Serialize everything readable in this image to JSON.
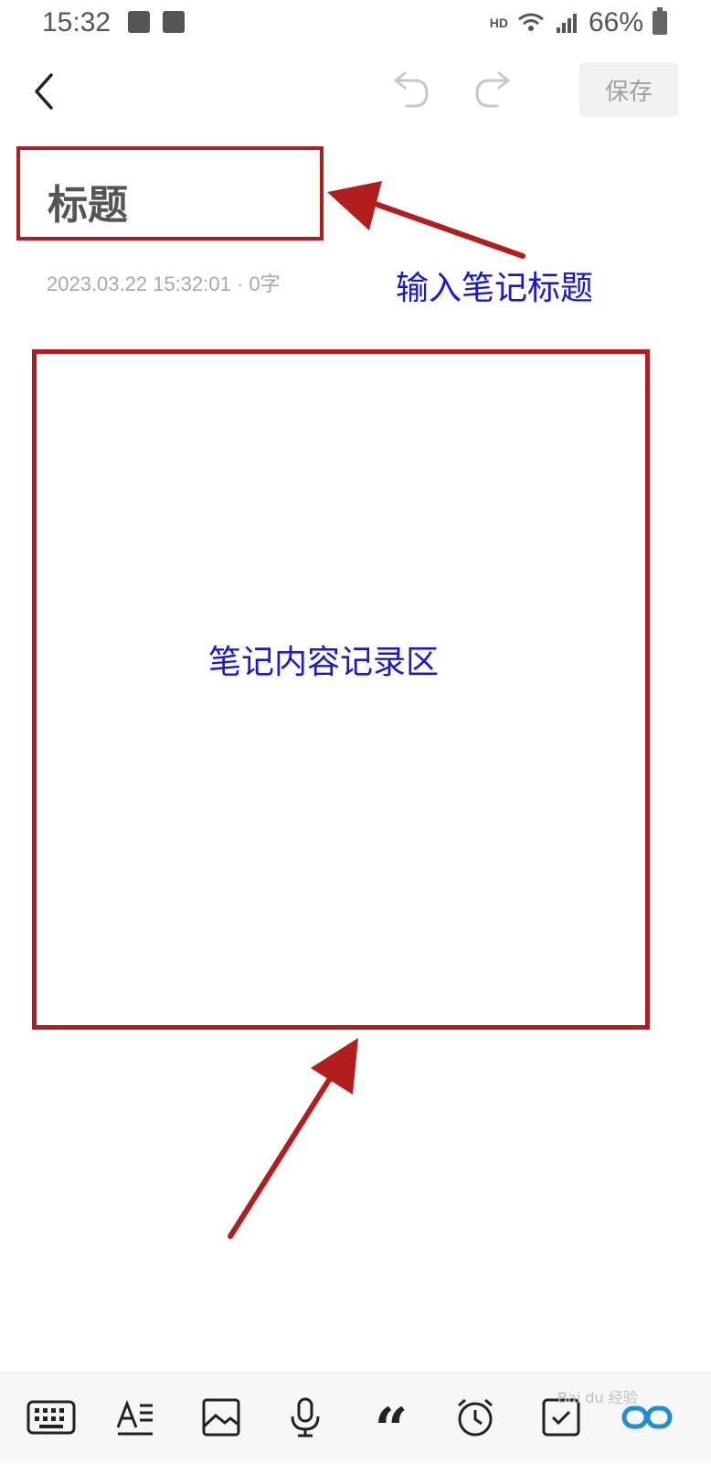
{
  "status_bar": {
    "time": "15:32",
    "network_label": "HD",
    "battery_percent": "66%",
    "icons": [
      "image-icon",
      "check-icon",
      "wifi-icon",
      "signal-4g-icon",
      "battery-icon"
    ]
  },
  "header": {
    "save_label": "保存",
    "icons": [
      "back-icon",
      "undo-icon",
      "redo-icon"
    ]
  },
  "note": {
    "title_placeholder": "标题",
    "meta": "2023.03.22 15:32:01 · 0字",
    "content_value": ""
  },
  "annotations": {
    "title_hint": "输入笔记标题",
    "content_hint": "笔记内容记录区",
    "color_box": "#b21e1e",
    "color_text": "#1a1acc"
  },
  "toolbar": {
    "items": [
      "keyboard-icon",
      "text-format-icon",
      "image-icon",
      "microphone-icon",
      "quote-icon",
      "alarm-icon",
      "checklist-icon",
      "link-icon"
    ]
  },
  "watermark": "Bai du 经验"
}
